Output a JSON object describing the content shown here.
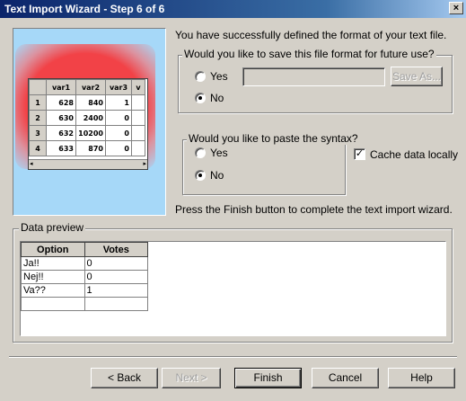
{
  "window": {
    "title": "Text Import Wizard - Step 6 of 6",
    "close_glyph": "×"
  },
  "sample_grid": {
    "headers": [
      "",
      "var1",
      "var2",
      "var3",
      "v"
    ],
    "rows": [
      [
        "1",
        "628",
        "840",
        "1",
        ""
      ],
      [
        "2",
        "630",
        "2400",
        "0",
        ""
      ],
      [
        "3",
        "632",
        "10200",
        "0",
        ""
      ],
      [
        "4",
        "633",
        "870",
        "0",
        ""
      ]
    ]
  },
  "intro_text": "You have successfully defined the format of your text file.",
  "save_format": {
    "legend": "Would you like to save this file format for future use?",
    "yes_label": "Yes",
    "no_label": "No",
    "selected": "No",
    "file_value": "",
    "save_as_label": "Save As..."
  },
  "paste_syntax": {
    "legend": "Would you like to paste the syntax?",
    "yes_label": "Yes",
    "no_label": "No",
    "selected": "No"
  },
  "cache": {
    "label": "Cache data locally",
    "checked": true,
    "check_glyph": "✓"
  },
  "finish_hint": "Press the Finish button to complete the text import wizard.",
  "data_preview": {
    "legend": "Data preview",
    "columns": [
      "Option",
      "Votes"
    ],
    "rows": [
      [
        "Ja!!",
        "0"
      ],
      [
        "Nej!!",
        "0"
      ],
      [
        "Va??",
        "1"
      ],
      [
        "",
        ""
      ]
    ]
  },
  "buttons": {
    "back": "< Back",
    "next": "Next >",
    "finish": "Finish",
    "cancel": "Cancel",
    "help": "Help"
  }
}
